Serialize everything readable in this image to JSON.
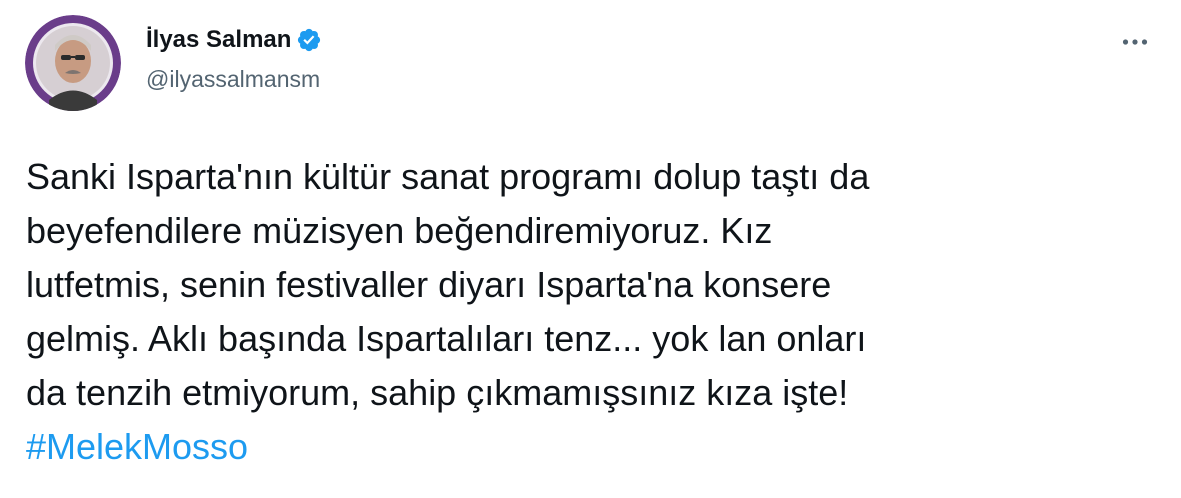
{
  "author": {
    "display_name": "İlyas Salman",
    "handle": "@ilyassalmansm",
    "verified": true,
    "avatar_icon": "profile-photo",
    "badge_icon": "verified-badge-icon"
  },
  "actions": {
    "more_icon": "more-options-icon",
    "more_label": "•••"
  },
  "tweet": {
    "lines": [
      "Sanki Isparta'nın kültür sanat programı dolup taştı da",
      "beyefendilere müzisyen beğendiremiyoruz. Kız",
      "lutfetmis, senin festivaller diyarı Isparta'na konsere",
      "gelmiş. Aklı başında Ispartalıları tenz... yok lan onları",
      "da tenzih etmiyorum, sahip çıkmamışsınız kıza işte!"
    ],
    "hashtag": "#MelekMosso"
  },
  "colors": {
    "text": "#0f1419",
    "secondary": "#536471",
    "accent": "#1d9bf0",
    "avatar_ring": "#6a3d8a",
    "background": "#ffffff"
  }
}
